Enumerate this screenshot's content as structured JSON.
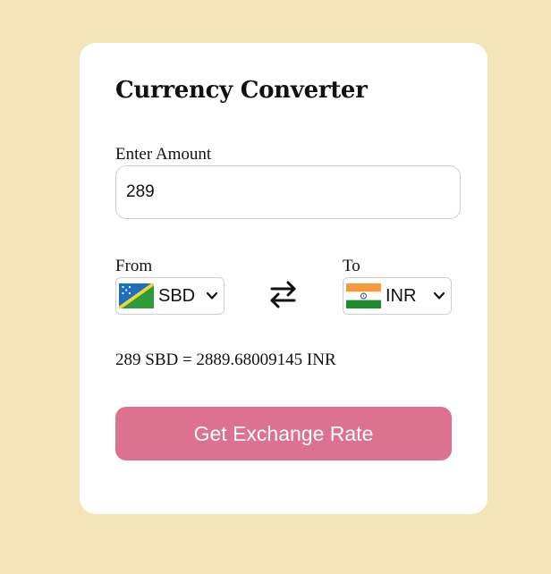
{
  "app": {
    "title": "Currency Converter"
  },
  "amount": {
    "label": "Enter Amount",
    "value": "289"
  },
  "from": {
    "label": "From",
    "code": "SBD",
    "flag_icon": "solomon-islands-flag-icon"
  },
  "to": {
    "label": "To",
    "code": "INR",
    "flag_icon": "india-flag-icon"
  },
  "swap_icon": "swap-arrows-icon",
  "result_text": "289 SBD = 2889.68009145 INR",
  "button_label": "Get Exchange Rate",
  "colors": {
    "page_background": "#f3e4b9",
    "card_background": "#ffffff",
    "button": "#dc7190",
    "button_text": "#ffffff"
  }
}
